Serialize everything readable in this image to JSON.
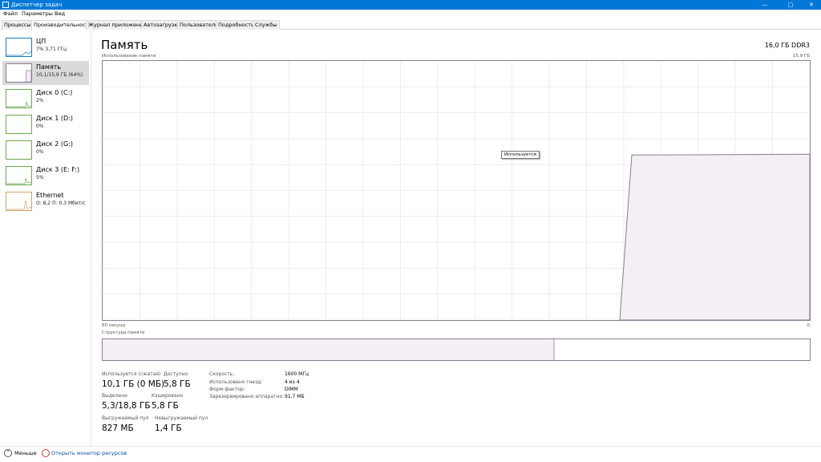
{
  "window": {
    "title": "Диспетчер задач",
    "minimize": "—",
    "maximize": "▢",
    "close": "✕"
  },
  "menu": [
    "Файл",
    "Параметры",
    "Вид"
  ],
  "tabs": [
    "Процессы",
    "Производительность",
    "Журнал приложений",
    "Автозагрузка",
    "Пользователи",
    "Подробности",
    "Службы"
  ],
  "active_tab": "Производительность",
  "sidebar": {
    "items": [
      {
        "name": "ЦП",
        "sub": "7% 3,71 ГГц",
        "color": "#1a7fb5"
      },
      {
        "name": "Память",
        "sub": "10,1/15,9 ГБ (64%)",
        "color": "#8b7c95"
      },
      {
        "name": "Диск 0 (C:)",
        "sub": "2%",
        "color": "#6aa84f"
      },
      {
        "name": "Диск 1 (D:)",
        "sub": "0%",
        "color": "#6aa84f"
      },
      {
        "name": "Диск 2 (G:)",
        "sub": "0%",
        "color": "#6aa84f"
      },
      {
        "name": "Диск 3 (E: F:)",
        "sub": "5%",
        "color": "#6aa84f"
      },
      {
        "name": "Ethernet",
        "sub": "О: 8,2 П: 0,3 Мбит/с",
        "color": "#c9a36a"
      }
    ],
    "selected": "Память"
  },
  "main": {
    "title": "Память",
    "mem_type": "16,0 ГБ DDR3",
    "graph_label": "Использование памяти",
    "graph_max": "15,9 ГБ",
    "tooltip": "Используется",
    "axis_left": "60 секунд",
    "axis_right": "0",
    "structure_label": "Структура памяти",
    "usage_fraction": 0.64,
    "structure_used_fraction": 0.64
  },
  "stats": {
    "in_use_label": "Используется (сжатая)",
    "in_use_value": "10,1 ГБ (0 МБ)",
    "available_label": "Доступно",
    "available_value": "5,8 ГБ",
    "committed_label": "Выделено",
    "committed_value": "5,3/18,8 ГБ",
    "cached_label": "Кэшировано",
    "cached_value": "5,8 ГБ",
    "paged_label": "Выгружаемый пул",
    "paged_value": "827 МБ",
    "nonpaged_label": "Невыгружаемый пул",
    "nonpaged_value": "1,4 ГБ"
  },
  "props": {
    "speed_label": "Скорость:",
    "speed_value": "1600 МГц",
    "slots_label": "Использовано гнезд:",
    "slots_value": "4 из 4",
    "form_label": "Форм-фактор:",
    "form_value": "DIMM",
    "reserved_label": "Зарезервировано аппаратно:",
    "reserved_value": "91,7 МБ"
  },
  "footer": {
    "less": "Меньше",
    "monitor": "Открыть монитор ресурсов"
  },
  "colors": {
    "accent": "#0078d7",
    "memory": "#8b7c95",
    "memory_fill": "#f3eff4",
    "grid": "#ebe6ee"
  }
}
